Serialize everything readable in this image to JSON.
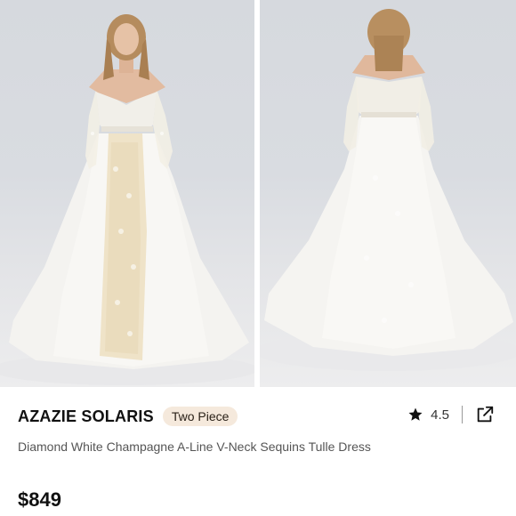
{
  "gallery": {
    "images": [
      {
        "view": "front"
      },
      {
        "view": "back"
      }
    ]
  },
  "product": {
    "brand": "AZAZIE SOLARIS",
    "badge": "Two Piece",
    "title": "Diamond White Champagne A-Line V-Neck Sequins Tulle Dress",
    "price": "$849",
    "rating": "4.5"
  },
  "icons": {
    "rating": "star-icon",
    "share": "share-external-icon"
  },
  "colors": {
    "badge_bg": "#f5e9dc",
    "text_primary": "#111111",
    "text_secondary": "#555555"
  }
}
